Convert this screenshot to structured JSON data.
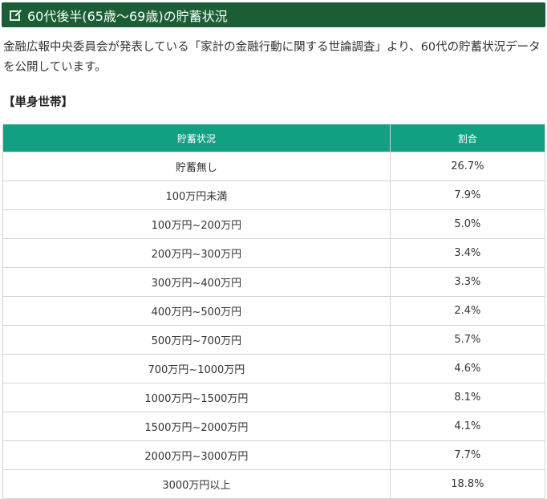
{
  "heading": {
    "icon": "edit-icon",
    "title": "60代後半(65歳～69歳)の貯蓄状況"
  },
  "intro": "金融広報中央委員会が発表している「家計の金融行動に関する世論調査」より、60代の貯蓄状況データを公開しています。",
  "subheading": "【単身世帯】",
  "colors": {
    "heading_bg": "#1b5e35",
    "table_header_bg": "#12a083"
  },
  "table": {
    "headers": [
      "貯蓄状況",
      "割合"
    ],
    "rows": [
      [
        "貯蓄無し",
        "26.7%"
      ],
      [
        "100万円未満",
        "7.9%"
      ],
      [
        "100万円~200万円",
        "5.0%"
      ],
      [
        "200万円~300万円",
        "3.4%"
      ],
      [
        "300万円~400万円",
        "3.3%"
      ],
      [
        "400万円~500万円",
        "2.4%"
      ],
      [
        "500万円~700万円",
        "5.7%"
      ],
      [
        "700万円~1000万円",
        "4.6%"
      ],
      [
        "1000万円~1500万円",
        "8.1%"
      ],
      [
        "1500万円~2000万円",
        "4.1%"
      ],
      [
        "2000万円~3000万円",
        "7.7%"
      ],
      [
        "3000万円以上",
        "18.8%"
      ]
    ]
  }
}
